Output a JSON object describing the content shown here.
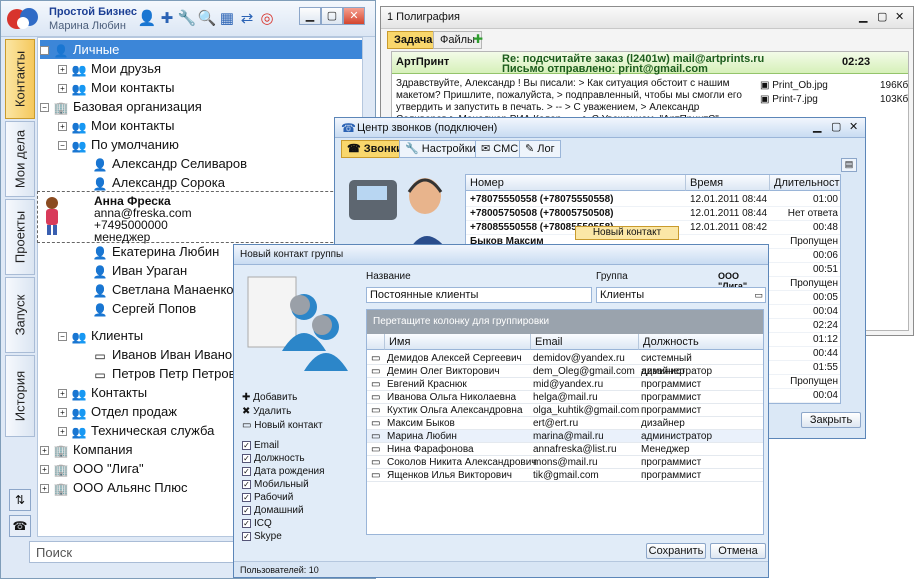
{
  "app": {
    "title": "Простой Бизнес",
    "user": "Марина Любин",
    "side_tabs": [
      "Контакты",
      "Мои дела",
      "Проекты",
      "Запуск",
      "История"
    ],
    "search_placeholder": "Поиск",
    "tree": [
      {
        "label": "Личные",
        "sel": true
      },
      {
        "label": "Мои друзья"
      },
      {
        "label": "Мои контакты"
      },
      {
        "label": "Базовая организация"
      },
      {
        "label": "Мои контакты"
      },
      {
        "label": "По умолчанию"
      },
      {
        "label": "Александр Селиваров"
      },
      {
        "label": "Александр Сорока"
      },
      {
        "label": "Екатерина Любин"
      },
      {
        "label": "Иван Ураган"
      },
      {
        "label": "Светлана Манаенко"
      },
      {
        "label": "Сергей Попов"
      },
      {
        "label": "Клиенты"
      },
      {
        "label": "Иванов Иван Иванович"
      },
      {
        "label": "Петров Петр Петрович"
      },
      {
        "label": "Контакты"
      },
      {
        "label": "Отдел продаж"
      },
      {
        "label": "Техническая служба"
      },
      {
        "label": "Компания"
      },
      {
        "label": "ООО \"Лига\""
      },
      {
        "label": "ООО Альянс Плюс"
      }
    ],
    "card": {
      "name": "Анна Фреска",
      "email": "anna@freska.com",
      "phone": "+7495000000",
      "role": "менеджер"
    }
  },
  "poly": {
    "title": "1 Полиграфия",
    "tabs": [
      "Задача",
      "Файлы"
    ],
    "from": "АртПринт",
    "subject": "Re: подсчитайте заказ (l2401w) mail@artprints.ru",
    "sent": "Письмо отправлено: print@gmail.com",
    "time": "02:23",
    "body": "Здравствуйте, Александр ! Вы писали: > Как ситуация обстоит с нашим макетом? Пришлите, пожалуйста, > подправленный, чтобы мы смогли его утвердить и запустить в печать. > -- > С уважением, > Александр Селиваров > Менеджер РИА Колор -- -- > С Уважением, \"АртПринтС\" Телефон: (499) 225-22-25 8(495)525-20-25 С уважением, Александр Селиваров",
    "files": [
      {
        "name": "Print_Ob.jpg",
        "size": "196Кб"
      },
      {
        "name": "Print-7.jpg",
        "size": "103Кб"
      }
    ]
  },
  "calls": {
    "title": "Центр звонков (подключен)",
    "tabs": [
      "Звонки",
      "Настройки",
      "СМС",
      "Лог"
    ],
    "headers": [
      "Номер",
      "Время",
      "Длительность"
    ],
    "rows": [
      {
        "num": "+78075550558 (+78075550558)",
        "time": "12.01.2011 08:44",
        "dur": "01:00"
      },
      {
        "num": "+78005750508 (+78005750508)",
        "time": "12.01.2011 08:44",
        "dur": "Нет ответа"
      },
      {
        "num": "+78085550558 (+78085550558)",
        "time": "12.01.2011 08:42",
        "dur": "00:48"
      },
      {
        "num": "Быков Максим",
        "time": "",
        "dur": "Пропущен"
      },
      {
        "num": "",
        "time": "",
        "dur": "00:06"
      },
      {
        "num": "",
        "time": "",
        "dur": "00:51"
      },
      {
        "num": "",
        "time": "",
        "dur": "Пропущен"
      },
      {
        "num": "",
        "time": "",
        "dur": "00:05"
      },
      {
        "num": "",
        "time": "",
        "dur": "00:04"
      },
      {
        "num": "",
        "time": "",
        "dur": "02:24"
      },
      {
        "num": "",
        "time": "",
        "dur": "01:12"
      },
      {
        "num": "",
        "time": "",
        "dur": "00:44"
      },
      {
        "num": "",
        "time": "",
        "dur": "01:55"
      },
      {
        "num": "",
        "time": "",
        "dur": "Пропущен"
      },
      {
        "num": "",
        "time": "",
        "dur": "00:04"
      }
    ],
    "context_menu": "Новый контакт",
    "close": "Закрыть"
  },
  "dialog": {
    "title": "Новый контакт группы",
    "name_label": "Название",
    "name_value": "Постоянные клиенты",
    "group_label": "Группа",
    "group_value": "Клиенты",
    "org": "ООО \"Лига\"",
    "group_hint": "Перетащите колонку для группировки",
    "headers": [
      "Имя",
      "Email",
      "Должность"
    ],
    "rows": [
      [
        "Демидов Алексей Сергеевич",
        "demidov@yandex.ru",
        "системный администратор"
      ],
      [
        "Демин Олег Викторович",
        "dem_Oleg@gmail.com",
        "дизайнер"
      ],
      [
        "Евгений Краснюк",
        "mid@yandex.ru",
        "программист"
      ],
      [
        "Иванова Ольга Николаевна",
        "helga@mail.ru",
        "программист"
      ],
      [
        "Кухтик Ольга Александровна",
        "olga_kuhtik@gmail.com",
        "программист"
      ],
      [
        "Максим Быков",
        "ert@ert.ru",
        "дизайнер"
      ],
      [
        "Марина Любин",
        "marina@mail.ru",
        "администратор"
      ],
      [
        "Нина Фарафонова",
        "annafreska@list.ru",
        "Менеджер"
      ],
      [
        "Соколов Никита Александрович",
        "mons@mail.ru",
        "программист"
      ],
      [
        "Ященков Илья Викторович",
        "tik@gmail.com",
        "программист"
      ]
    ],
    "actions": [
      "Добавить",
      "Удалить",
      "Новый контакт"
    ],
    "fields": [
      "Email",
      "Должность",
      "Дата рождения",
      "Мобильный",
      "Рабочий",
      "Домашний",
      "ICQ",
      "Skype"
    ],
    "save": "Сохранить",
    "cancel": "Отмена",
    "footer": "Пользователей: 10"
  }
}
